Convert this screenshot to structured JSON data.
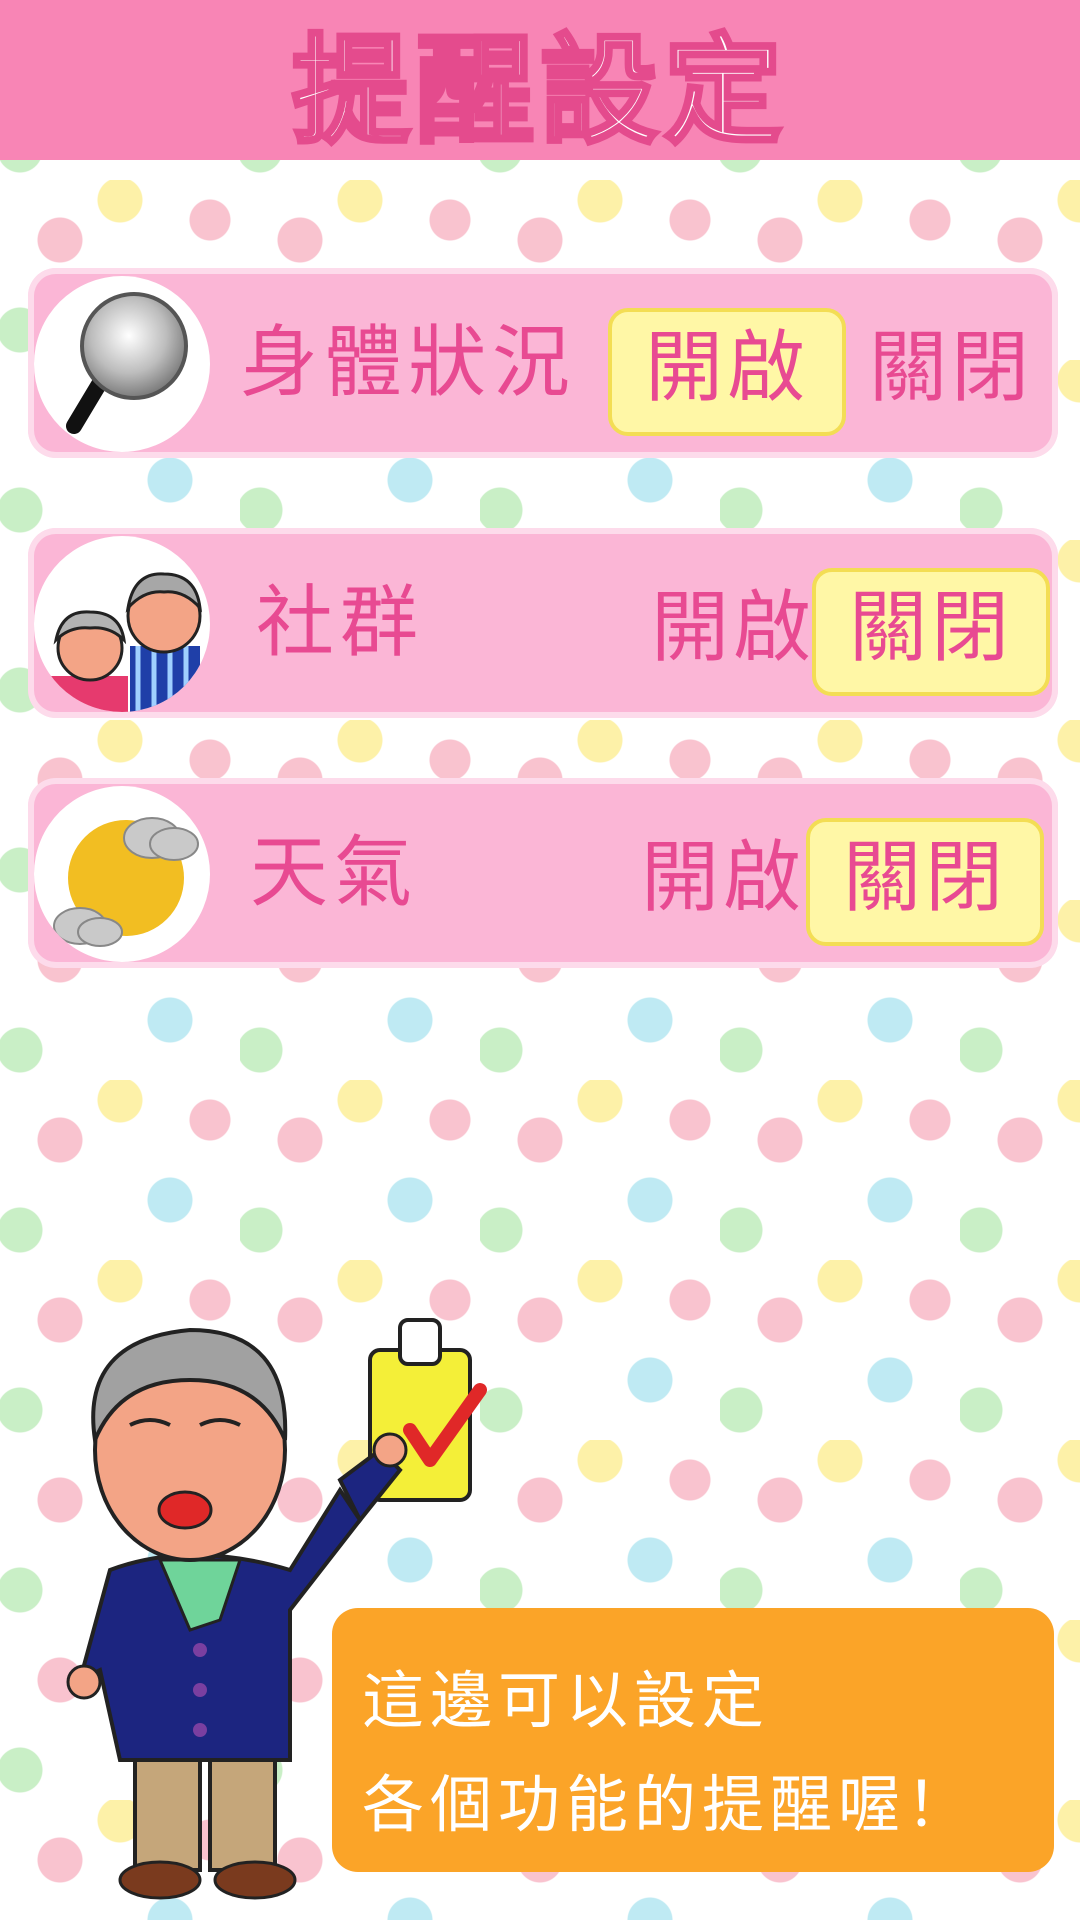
{
  "header": {
    "title": "提醒設定"
  },
  "reminders": [
    {
      "label": "身體狀況",
      "on_label": "開啟",
      "off_label": "關閉",
      "selected": "on",
      "icon": "magnifier-icon"
    },
    {
      "label": "社群",
      "on_label": "開啟",
      "off_label": "關閉",
      "selected": "off",
      "icon": "elderly-couple-icon"
    },
    {
      "label": "天氣",
      "on_label": "開啟",
      "off_label": "關閉",
      "selected": "off",
      "icon": "sun-cloud-icon"
    }
  ],
  "mascot": {
    "line1": "這邊可以設定",
    "line2": "各個功能的提醒喔！"
  },
  "colors": {
    "header": "#f885b5",
    "row": "#fbb6d6",
    "text": "#e84a92",
    "selected": "#fff7a6",
    "bubble": "#fba428"
  }
}
